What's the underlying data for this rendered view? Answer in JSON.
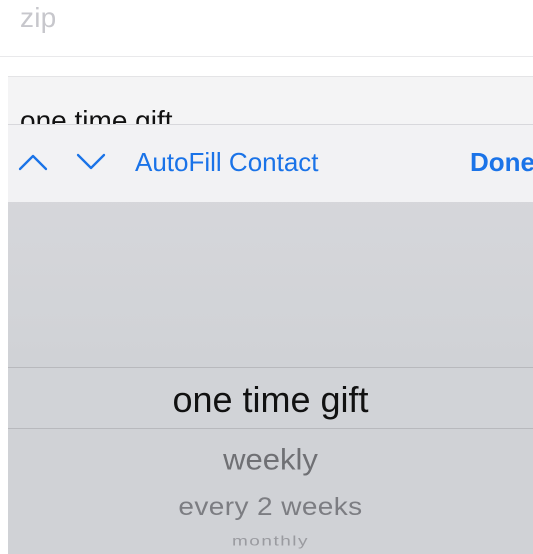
{
  "form": {
    "zip": {
      "placeholder": "zip"
    },
    "frequency_select": {
      "value": "one time gift"
    }
  },
  "toolbar": {
    "previous_icon": "chevron-up-icon",
    "next_icon": "chevron-down-icon",
    "autofill_label": "AutoFill Contact",
    "done_label": "Done",
    "accent_color": "#1a73e8"
  },
  "picker": {
    "options": [
      "one time gift",
      "weekly",
      "every 2 weeks",
      "monthly"
    ],
    "selected": "one time gift"
  }
}
